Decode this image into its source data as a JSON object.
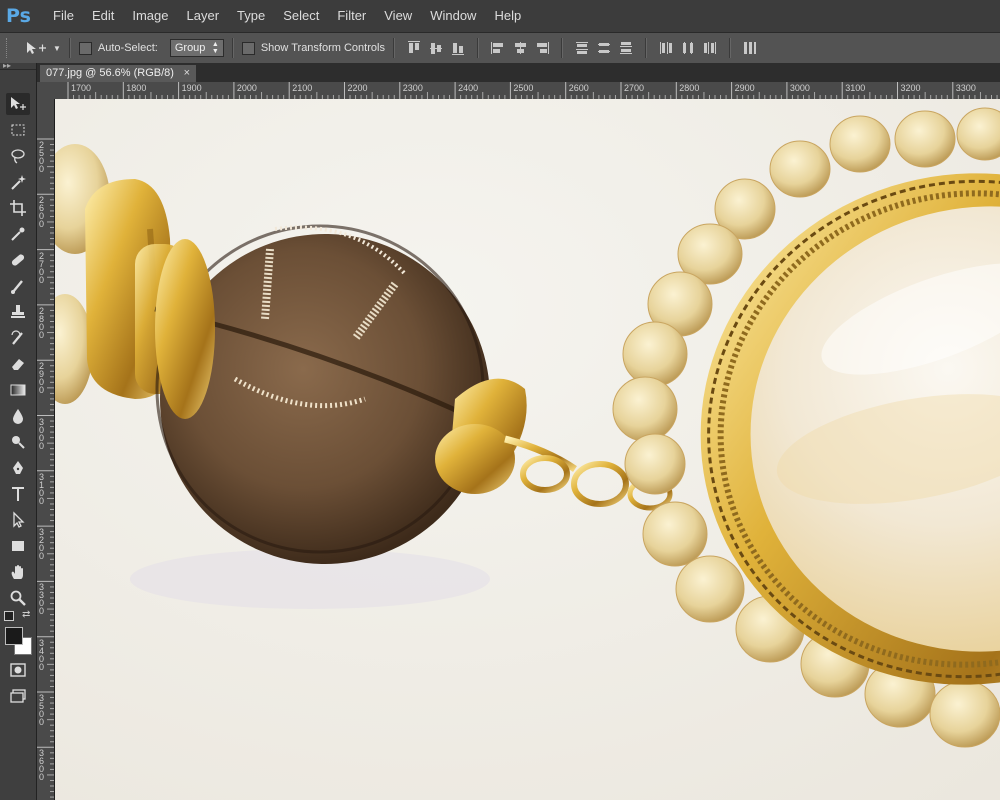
{
  "app": {
    "logo": "Ps"
  },
  "menu": [
    "File",
    "Edit",
    "Image",
    "Layer",
    "Type",
    "Select",
    "Filter",
    "View",
    "Window",
    "Help"
  ],
  "options": {
    "auto_select_label": "Auto-Select:",
    "group_value": "Group",
    "show_transform_label": "Show Transform Controls"
  },
  "document": {
    "tab_title": "077.jpg @ 56.6% (RGB/8)",
    "close_glyph": "×"
  },
  "ruler": {
    "h_labels": [
      "1700",
      "1800",
      "1900",
      "2000",
      "2100",
      "2200",
      "2300",
      "2400",
      "2500",
      "2600",
      "2700",
      "2800",
      "2900",
      "3000",
      "3100",
      "3200",
      "3300"
    ],
    "v_labels": [
      "2500",
      "2600",
      "2700",
      "2800",
      "2900",
      "3000",
      "3100",
      "3200",
      "3300",
      "3400",
      "3500",
      "3600"
    ]
  },
  "tools": [
    "move-tool",
    "marquee-tool",
    "lasso-tool",
    "magic-wand-tool",
    "crop-tool",
    "eyedropper-tool",
    "healing-brush-tool",
    "brush-tool",
    "clone-stamp-tool",
    "history-brush-tool",
    "eraser-tool",
    "gradient-tool",
    "blur-tool",
    "dodge-tool",
    "pen-tool",
    "type-tool",
    "path-selection-tool",
    "rectangle-tool",
    "hand-tool",
    "zoom-tool"
  ],
  "colors": {
    "foreground": "#1a1a1a",
    "background": "#ffffff",
    "accent": "#5aa9e6"
  }
}
